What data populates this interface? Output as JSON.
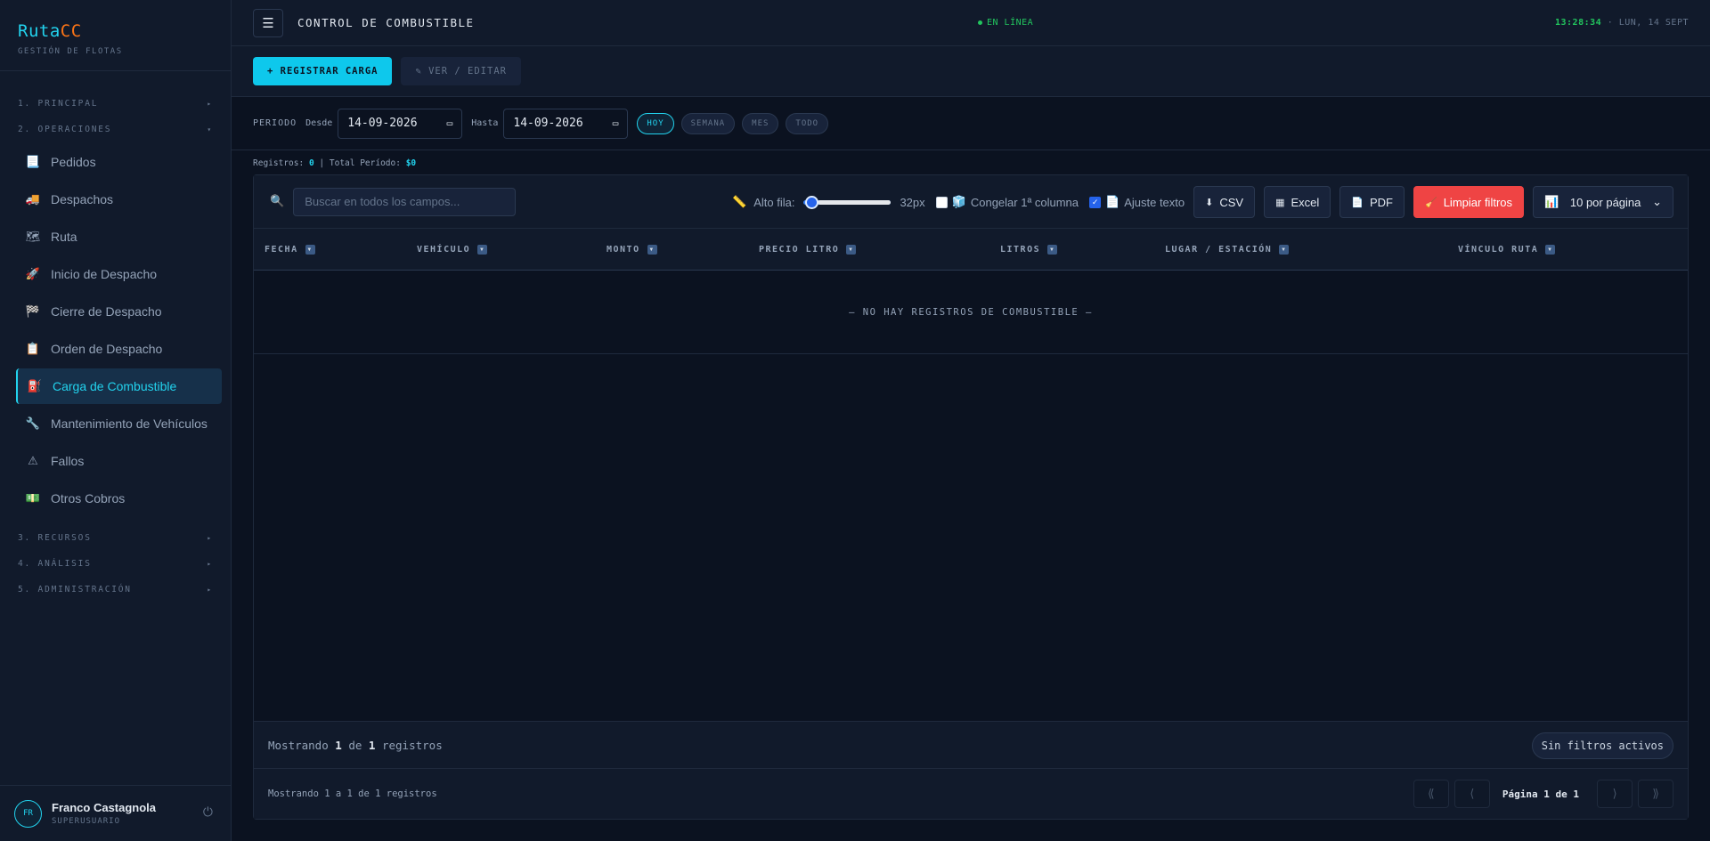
{
  "brand": {
    "name_a": "Ruta",
    "name_b": "CC",
    "subtitle": "GESTIÓN DE FLOTAS"
  },
  "sidebar": {
    "sections": [
      {
        "label": "1. PRINCIPAL",
        "arrow": "▸"
      },
      {
        "label": "2. OPERACIONES",
        "arrow": "▾"
      },
      {
        "label": "3. RECURSOS",
        "arrow": "▸"
      },
      {
        "label": "4. ANÁLISIS",
        "arrow": "▸"
      },
      {
        "label": "5. ADMINISTRACIÓN",
        "arrow": "▸"
      }
    ],
    "items": [
      {
        "label": "Pedidos",
        "icon": "📃"
      },
      {
        "label": "Despachos",
        "icon": "🚚"
      },
      {
        "label": "Ruta",
        "icon": "🗺"
      },
      {
        "label": "Inicio de Despacho",
        "icon": "🚀"
      },
      {
        "label": "Cierre de Despacho",
        "icon": "🏁"
      },
      {
        "label": "Orden de Despacho",
        "icon": "📋"
      },
      {
        "label": "Carga de Combustible",
        "icon": "⛽"
      },
      {
        "label": "Mantenimiento de Vehículos",
        "icon": "🔧"
      },
      {
        "label": "Fallos",
        "icon": "⚠"
      },
      {
        "label": "Otros Cobros",
        "icon": "💵"
      }
    ]
  },
  "user": {
    "initials": "FR",
    "name": "Franco Castagnola",
    "role": "SUPERUSUARIO"
  },
  "header": {
    "menu_icon": "☰",
    "title": "CONTROL DE COMBUSTIBLE",
    "status": "EN LÍNEA",
    "time": "13:28:34",
    "date": "· LUN, 14 SEPT"
  },
  "actions": {
    "register": "+ REGISTRAR CARGA",
    "view_edit": "✎ VER / EDITAR"
  },
  "filters": {
    "period": "PERIODO",
    "from_label": "Desde",
    "from_value": "14-09-2026",
    "to_label": "Hasta",
    "to_value": "14-09-2026",
    "ranges": [
      "HOY",
      "SEMANA",
      "MES",
      "TODO"
    ]
  },
  "summary": {
    "records_label": "Registros:",
    "records": "0",
    "sep": "|",
    "total_label": "Total Período:",
    "total": "$0"
  },
  "toolbar": {
    "search_placeholder": "Buscar en todos los campos...",
    "row_height_label": "Alto fila:",
    "row_height_value": "32px",
    "freeze_label": "Congelar 1ª columna",
    "wrap_label": "Ajuste texto",
    "csv": "CSV",
    "excel": "Excel",
    "pdf": "PDF",
    "clear": "Limpiar filtros",
    "per_page": "10 por página"
  },
  "table": {
    "columns": [
      "FECHA",
      "VEHÍCULO",
      "MONTO",
      "PRECIO LITRO",
      "LITROS",
      "LUGAR / ESTACIÓN",
      "VÍNCULO RUTA"
    ],
    "empty": "— NO HAY REGISTROS DE COMBUSTIBLE —"
  },
  "footer": {
    "showing_prefix": "Mostrando",
    "showing_a": "1",
    "showing_mid": "de",
    "showing_b": "1",
    "showing_suffix": "registros",
    "no_filters": "Sin filtros activos",
    "range_text": "Mostrando 1 a 1 de 1 registros",
    "page_label": "Página",
    "page": "1",
    "of": "de",
    "pages": "1"
  },
  "colors": {
    "accent": "#22d3ee",
    "brand_orange": "#f97316",
    "online": "#22c55e",
    "danger": "#ef4444"
  }
}
